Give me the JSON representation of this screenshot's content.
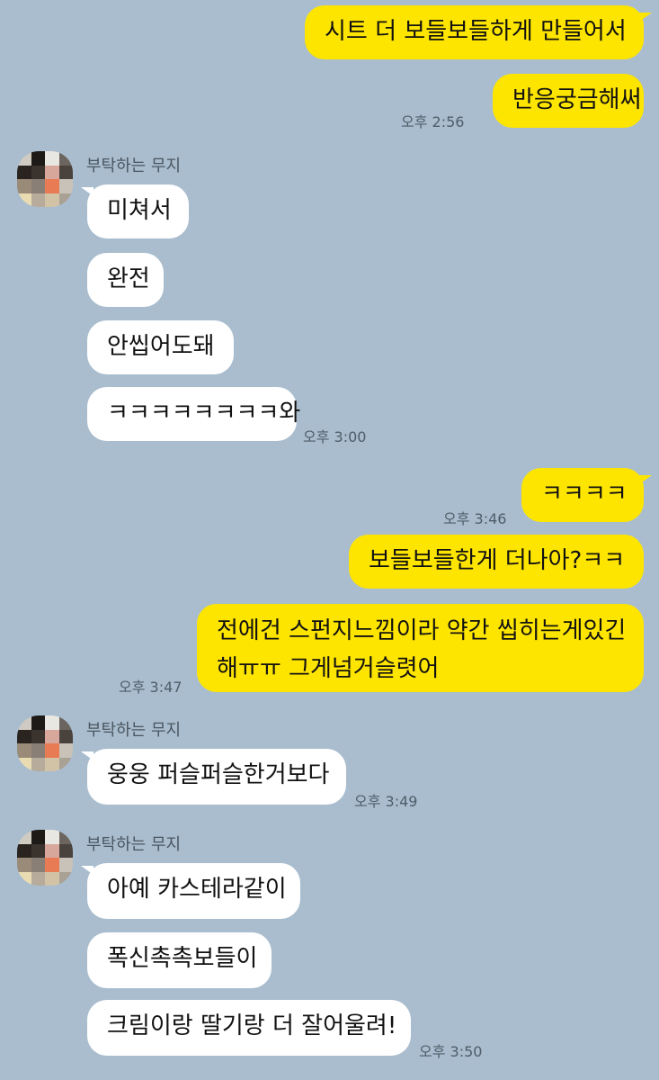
{
  "colors": {
    "background": "#a9bdce",
    "my_bubble": "#fee500",
    "other_bubble": "#ffffff"
  },
  "sender_name": "부탁하는 무지",
  "messages": {
    "m1": "시트 더 보들보들하게 만들어서",
    "m2": "반응궁금해써",
    "t1": "오후 2:56",
    "o1": "미쳐서",
    "o2": "완전",
    "o3": "안씹어도돼",
    "o4": "ㅋㅋㅋㅋㅋㅋㅋㅋ와",
    "t2": "오후 3:00",
    "m3": "ㅋㅋㅋㅋ",
    "t3": "오후 3:46",
    "m4": "보들보들한게 더나아?ㅋㅋ",
    "m5_line1": "전에건 스펀지느낌이라 약간 씹히는게있긴",
    "m5_line2": "해ㅠㅠ 그게넘거슬렷어",
    "t4": "오후 3:47",
    "o5": "웅웅 퍼슬퍼슬한거보다",
    "t5": "오후 3:49",
    "o6": "아예 카스테라같이",
    "o7": "폭신촉촉보들이",
    "o8": "크림이랑 딸기랑 더 잘어울려!",
    "t6": "오후 3:50"
  }
}
